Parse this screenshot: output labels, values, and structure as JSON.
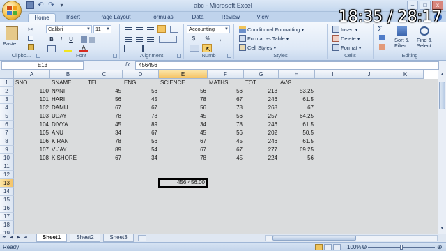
{
  "window": {
    "title": "abc - Microsoft Excel",
    "timer": "18:35 / 28:17",
    "controls": [
      "–",
      "□",
      "x"
    ]
  },
  "tabs": [
    "Home",
    "Insert",
    "Page Layout",
    "Formulas",
    "Data",
    "Review",
    "View"
  ],
  "active_tab": "Home",
  "ribbon": {
    "clipboard": {
      "label": "Clipbo...",
      "paste_label": "Paste"
    },
    "font": {
      "label": "Font",
      "font_name": "Calibri",
      "font_size": "11",
      "bold": "B",
      "italic": "I",
      "underline": "U"
    },
    "alignment": {
      "label": "Alignment"
    },
    "number": {
      "label": "Numb",
      "format": "Accounting",
      "currency": "$",
      "percent": "%",
      "comma": ","
    },
    "styles": {
      "label": "Styles",
      "conditional": "Conditional Formatting",
      "format_table": "Format as Table",
      "cell_styles": "Cell Styles"
    },
    "cells": {
      "label": "Cells",
      "insert": "Insert",
      "delete": "Delete",
      "format": "Format"
    },
    "editing": {
      "label": "Editing",
      "sigma": "Σ",
      "sort_line1": "Sort &",
      "sort_line2": "Filter",
      "find_line1": "Find &",
      "find_line2": "Select"
    }
  },
  "formula_bar": {
    "name_box": "E13",
    "fx": "fx",
    "content": "456456"
  },
  "columns": [
    "A",
    "B",
    "C",
    "D",
    "E",
    "F",
    "G",
    "H",
    "I",
    "J",
    "K"
  ],
  "selected_column": "E",
  "rows": [
    "1",
    "2",
    "3",
    "4",
    "5",
    "6",
    "7",
    "8",
    "9",
    "10",
    "11",
    "12",
    "13",
    "14",
    "15",
    "16",
    "17",
    "18",
    "19"
  ],
  "selected_row": "13",
  "table": {
    "header": [
      "SNO",
      "SNAME",
      "TEL",
      "ENG",
      "SCIENCE",
      "MATHS",
      "TOT",
      "AVG"
    ],
    "records": [
      [
        "100",
        "NANI",
        "45",
        "56",
        "56",
        "56",
        "213",
        "53.25"
      ],
      [
        "101",
        "HARI",
        "56",
        "45",
        "78",
        "67",
        "246",
        "61.5"
      ],
      [
        "102",
        "DAMU",
        "67",
        "67",
        "56",
        "78",
        "268",
        "67"
      ],
      [
        "103",
        "UDAY",
        "78",
        "78",
        "45",
        "56",
        "257",
        "64.25"
      ],
      [
        "104",
        "DIVYA",
        "45",
        "89",
        "34",
        "78",
        "246",
        "61.5"
      ],
      [
        "105",
        "ANU",
        "34",
        "67",
        "45",
        "56",
        "202",
        "50.5"
      ],
      [
        "106",
        "KIRAN",
        "78",
        "56",
        "67",
        "45",
        "246",
        "61.5"
      ],
      [
        "107",
        "VIJAY",
        "89",
        "54",
        "67",
        "67",
        "277",
        "69.25"
      ],
      [
        "108",
        "KISHORE",
        "67",
        "34",
        "78",
        "45",
        "224",
        "56"
      ]
    ]
  },
  "active_cell_value": "456,456.00",
  "sheets": [
    "Sheet1",
    "Sheet2",
    "Sheet3"
  ],
  "active_sheet": "Sheet1",
  "status": {
    "text": "Ready",
    "zoom": "100%",
    "zoom_fraction": 0.5
  }
}
